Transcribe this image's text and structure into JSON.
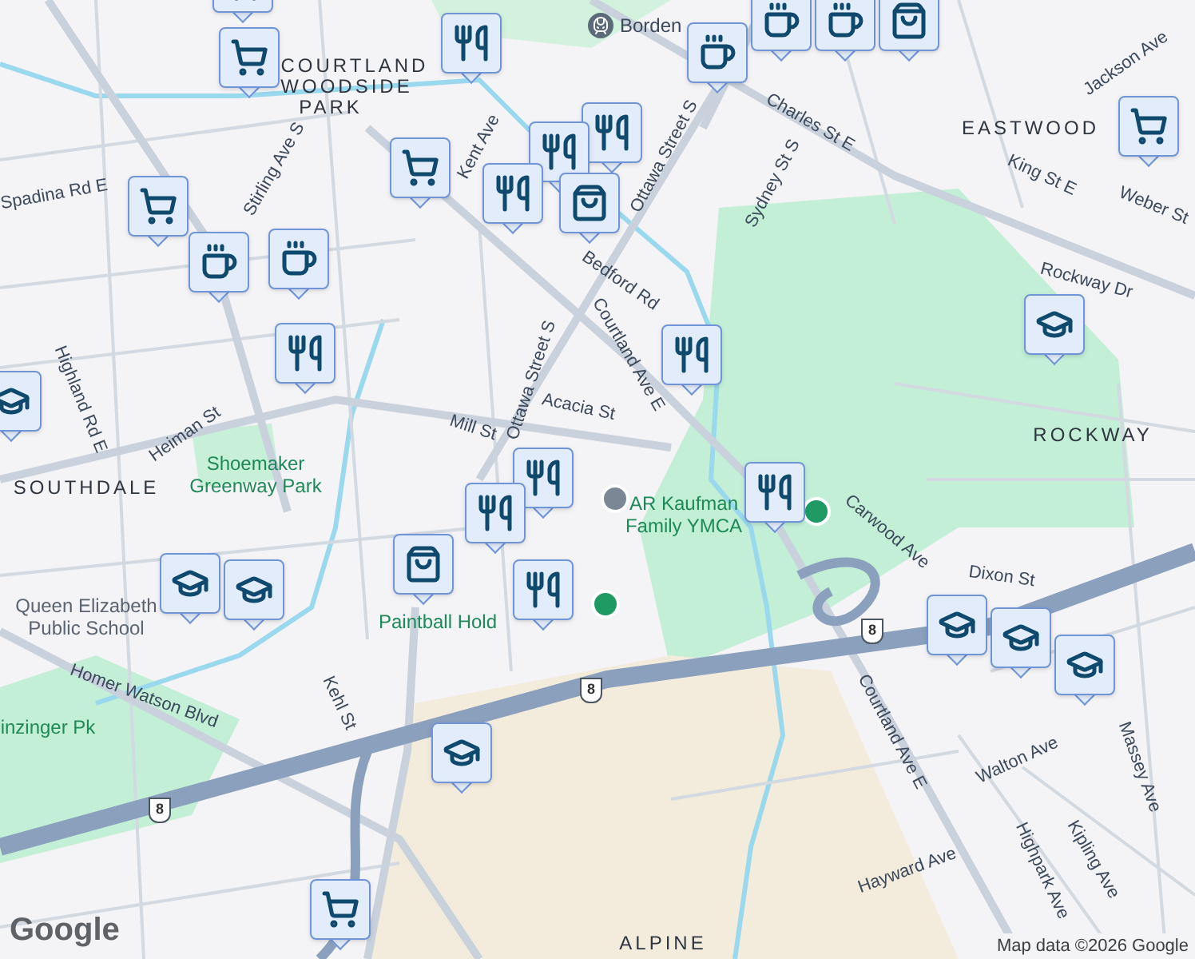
{
  "map": {
    "transit_station": "Borden",
    "labels": [
      {
        "text": "COURTLAND",
        "kind": "area"
      },
      {
        "text": "WOODSIDE",
        "kind": "area"
      },
      {
        "text": "PARK",
        "kind": "area"
      },
      {
        "text": "Kent Ave",
        "kind": "street"
      },
      {
        "text": "Stirling Ave S",
        "kind": "street"
      },
      {
        "text": "Spadina Rd E",
        "kind": "street"
      },
      {
        "text": "Ottawa Street S",
        "kind": "street"
      },
      {
        "text": "Charles St E",
        "kind": "street"
      },
      {
        "text": "Sydney St S",
        "kind": "street"
      },
      {
        "text": "King St E",
        "kind": "street"
      },
      {
        "text": "EASTWOOD",
        "kind": "area"
      },
      {
        "text": "Jackson Ave",
        "kind": "street"
      },
      {
        "text": "Weber St",
        "kind": "street"
      },
      {
        "text": "Rockway Dr",
        "kind": "street"
      },
      {
        "text": "Bedford Rd",
        "kind": "street"
      },
      {
        "text": "Courtland Ave E",
        "kind": "street"
      },
      {
        "text": "Ottawa Street S",
        "kind": "street"
      },
      {
        "text": "Acacia St",
        "kind": "street"
      },
      {
        "text": "Mill St",
        "kind": "street"
      },
      {
        "text": "Highland Rd E",
        "kind": "street"
      },
      {
        "text": "Heiman St",
        "kind": "street"
      },
      {
        "text": "Shoemaker Greenway Park",
        "kind": "park"
      },
      {
        "text": "ROCKWAY",
        "kind": "area"
      },
      {
        "text": "SOUTHDALE",
        "kind": "area"
      },
      {
        "text": "AR Kaufman Family YMCA",
        "kind": "park"
      },
      {
        "text": "Carwood Ave",
        "kind": "street"
      },
      {
        "text": "Dixon St",
        "kind": "street"
      },
      {
        "text": "Queen Elizabeth Public School",
        "kind": "poi"
      },
      {
        "text": "Homer Watson Blvd",
        "kind": "street"
      },
      {
        "text": "inzinger Pk",
        "kind": "park"
      },
      {
        "text": "Kehl St",
        "kind": "street"
      },
      {
        "text": "Paintball Hold",
        "kind": "park"
      },
      {
        "text": "Walton Ave",
        "kind": "street"
      },
      {
        "text": "Massey Ave",
        "kind": "street"
      },
      {
        "text": "Kipling Ave",
        "kind": "street"
      },
      {
        "text": "Highpark Ave",
        "kind": "street"
      },
      {
        "text": "Hayward Ave",
        "kind": "street"
      },
      {
        "text": "Courtland Ave E",
        "kind": "street"
      },
      {
        "text": "ALPINE",
        "kind": "area"
      }
    ],
    "route_shields": [
      "8",
      "8",
      "8"
    ],
    "pins": [
      {
        "kind": "grocery"
      },
      {
        "kind": "grocery"
      },
      {
        "kind": "restaurant"
      },
      {
        "kind": "cafe"
      },
      {
        "kind": "cafe"
      },
      {
        "kind": "shopping"
      },
      {
        "kind": "cafe"
      },
      {
        "kind": "grocery"
      },
      {
        "kind": "restaurant"
      },
      {
        "kind": "restaurant"
      },
      {
        "kind": "grocery"
      },
      {
        "kind": "restaurant"
      },
      {
        "kind": "shopping"
      },
      {
        "kind": "grocery"
      },
      {
        "kind": "cafe"
      },
      {
        "kind": "cafe"
      },
      {
        "kind": "restaurant"
      },
      {
        "kind": "restaurant"
      },
      {
        "kind": "school"
      },
      {
        "kind": "school"
      },
      {
        "kind": "restaurant"
      },
      {
        "kind": "restaurant"
      },
      {
        "kind": "restaurant"
      },
      {
        "kind": "shopping"
      },
      {
        "kind": "restaurant"
      },
      {
        "kind": "school"
      },
      {
        "kind": "school"
      },
      {
        "kind": "school"
      },
      {
        "kind": "school"
      },
      {
        "kind": "school"
      },
      {
        "kind": "school"
      },
      {
        "kind": "grocery"
      }
    ],
    "logo": "Google",
    "attribution": "Map data ©2026 Google"
  }
}
